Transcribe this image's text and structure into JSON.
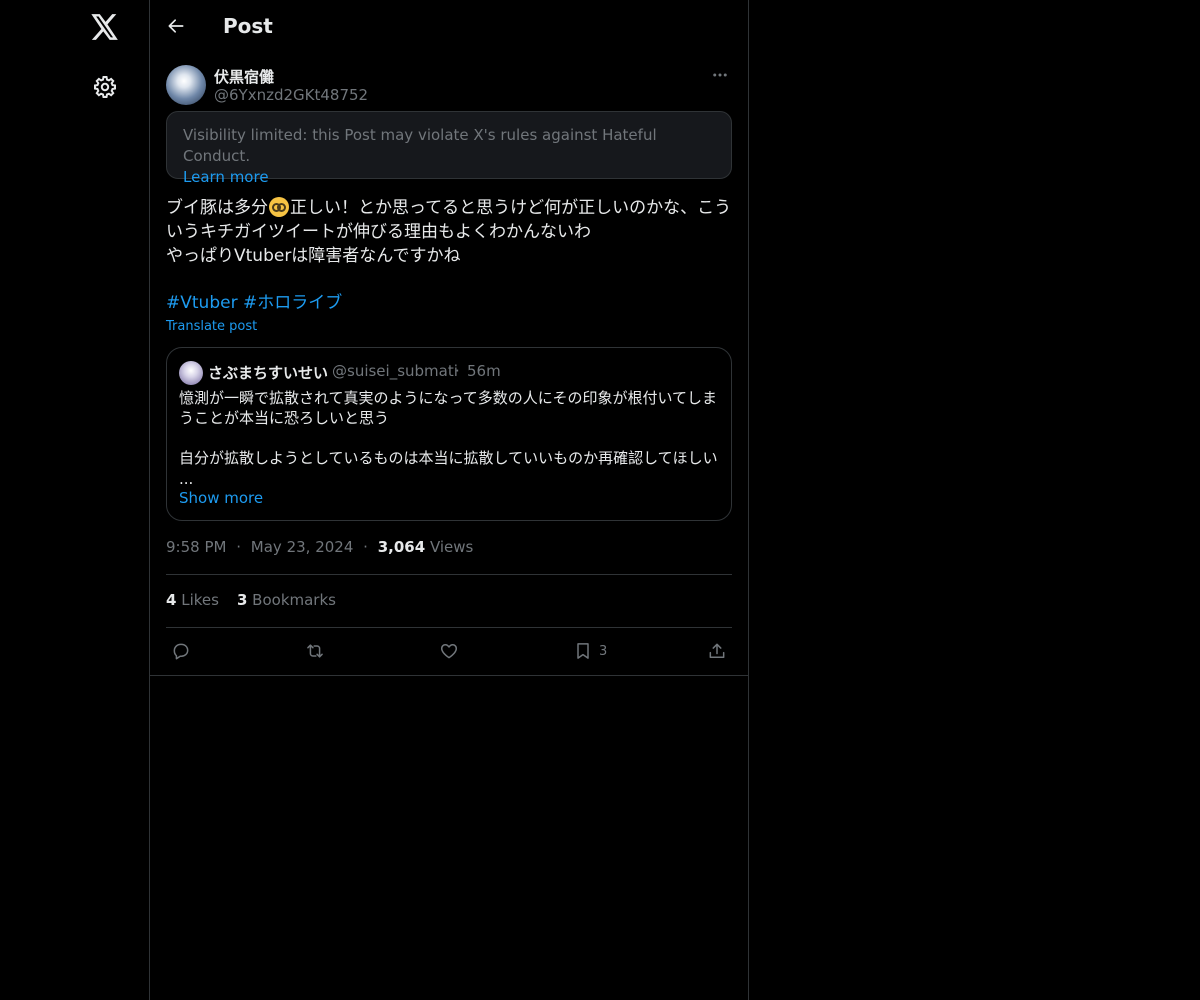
{
  "nav": {
    "logo_icon": "x-logo-icon",
    "settings_icon": "gear-icon"
  },
  "header": {
    "back_icon": "arrow-left-icon",
    "title": "Post"
  },
  "post": {
    "author": {
      "name": "伏黒宿儺",
      "handle": "@6Yxnzd2GKt48752"
    },
    "notice": {
      "text": "Visibility limited: this Post may violate X's rules against Hateful Conduct.",
      "link": "Learn more"
    },
    "text_line1_a": "ブイ豚は多分",
    "emoji": "nerd-face-emoji",
    "text_line1_b": "正しい！とか思ってると思うけど何が正しいのかな、こういうキチガイツイートが伸びる理由もよくわかんないわ",
    "text_line2": "やっぱりVtuberは障害者なんですかね",
    "hashtags": [
      "#Vtuber",
      "#ホロライブ"
    ],
    "translate": "Translate post",
    "quote": {
      "name": "さぶまちすいせい",
      "handle": "@suisei_submati",
      "dot": "·",
      "time": "56m",
      "line1": "憶測が一瞬で拡散されて真実のようになって多数の人にその印象が根付いてしまうことが本当に恐ろしいと思う",
      "line2": "自分が拡散しようとしているものは本当に拡散していいものか再確認してほしい",
      "ellipsis": "...",
      "show_more": "Show more"
    },
    "meta": {
      "time": "9:58 PM",
      "sep": "·",
      "date": "May 23, 2024",
      "views_count": "3,064",
      "views_label": "Views"
    },
    "counts": {
      "likes": "4",
      "likes_label": "Likes",
      "bookmarks": "3",
      "bookmarks_label": "Bookmarks"
    },
    "actions": {
      "bookmark_count": "3"
    }
  },
  "colors": {
    "background": "#000000",
    "text": "#e7e9ea",
    "muted": "#71767b",
    "accent": "#1d9bf0",
    "border": "#2f3336"
  }
}
